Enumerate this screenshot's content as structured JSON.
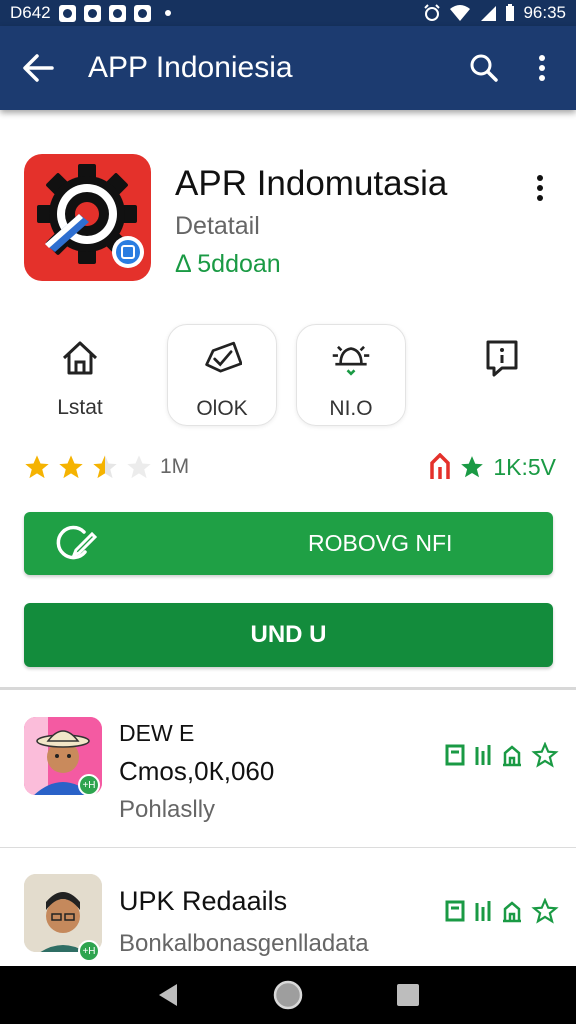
{
  "status_bar": {
    "left_text": "D642",
    "right_text": "96:35"
  },
  "app_bar": {
    "title": "APP Indoniesia"
  },
  "app": {
    "name": "APR Indomutasia",
    "subtitle": "Detatail",
    "developer": "Δ 5ddoan"
  },
  "actions": [
    {
      "label": "Lstat",
      "icon": "home-icon"
    },
    {
      "label": "OlOK",
      "icon": "tag-check-icon"
    },
    {
      "label": "NI.O",
      "icon": "bell-icon"
    },
    {
      "label": "",
      "icon": "bookmark-icon"
    }
  ],
  "rating": {
    "stars": 2.5,
    "text": "1М",
    "right_text": "1K:5V"
  },
  "buttons": {
    "primary_label": "ROBOVG NFI",
    "secondary_label": "UND U"
  },
  "list_items": [
    {
      "title": "DEW E",
      "line2": "Cmos,0К,060",
      "line3": "Pohlaslly",
      "badge": "+H"
    },
    {
      "title": "UPK Redaails",
      "line2": "",
      "line3": "Bonkalbonasgenlladata",
      "badge": "+H"
    }
  ],
  "colors": {
    "app_bar": "#1c3b70",
    "status_bar": "#16325f",
    "primary_green": "#1fa045",
    "dark_green": "#138c3c",
    "app_icon_red": "#e4312b",
    "star": "#f5b301"
  }
}
